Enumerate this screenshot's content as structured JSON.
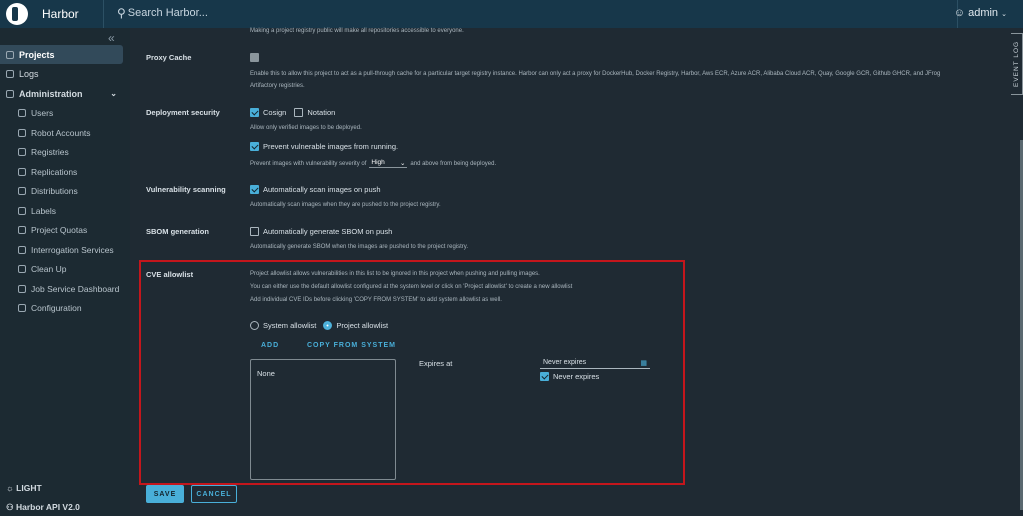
{
  "header": {
    "brand": "Harbor",
    "search_placeholder": "Search Harbor...",
    "user": "admin"
  },
  "sidebar": {
    "items": [
      {
        "label": "Projects",
        "icon": "projects-icon",
        "active": true
      },
      {
        "label": "Logs",
        "icon": "logs-icon"
      },
      {
        "label": "Administration",
        "icon": "administration-icon"
      },
      {
        "label": "Users",
        "icon": "users-icon"
      },
      {
        "label": "Robot Accounts",
        "icon": "robot-icon"
      },
      {
        "label": "Registries",
        "icon": "registries-icon"
      },
      {
        "label": "Replications",
        "icon": "replications-icon"
      },
      {
        "label": "Distributions",
        "icon": "distributions-icon"
      },
      {
        "label": "Labels",
        "icon": "labels-icon"
      },
      {
        "label": "Project Quotas",
        "icon": "quotas-icon"
      },
      {
        "label": "Interrogation Services",
        "icon": "interrogation-icon"
      },
      {
        "label": "Clean Up",
        "icon": "cleanup-icon"
      },
      {
        "label": "Job Service Dashboard",
        "icon": "dashboard-icon"
      },
      {
        "label": "Configuration",
        "icon": "configuration-icon"
      }
    ],
    "theme": "LIGHT",
    "api": "Harbor API V2.0"
  },
  "event_log": "EVENT LOG",
  "form": {
    "public_help": "Making a project registry public will make all repositories accessible to everyone.",
    "proxy_cache": {
      "label": "Proxy Cache",
      "help1": "Enable this to allow this project to act as a pull-through cache for a particular target registry instance. Harbor can only act a proxy for DockerHub, Docker Registry, Harbor, Aws ECR, Azure ACR, Alibaba Cloud ACR, Quay, Google GCR, Github GHCR, and JFrog",
      "help2": "Artifactory registries."
    },
    "deployment": {
      "label": "Deployment security",
      "cosign": "Cosign",
      "notation": "Notation",
      "help": "Allow only verified images to be deployed.",
      "prevent": "Prevent vulnerable images from running.",
      "severity_prefix": "Prevent images with vulnerability severity of",
      "severity": "High",
      "severity_suffix": "and above from being deployed."
    },
    "scanning": {
      "label": "Vulnerability scanning",
      "option": "Automatically scan images on push",
      "help": "Automatically scan images when they are pushed to the project registry."
    },
    "sbom": {
      "label": "SBOM generation",
      "option": "Automatically generate SBOM on push",
      "help": "Automatically generate SBOM when the images are pushed to the project registry."
    },
    "cve": {
      "label": "CVE allowlist",
      "help1": "Project allowlist allows vulnerabilities in this list to be ignored in this project when pushing and pulling images.",
      "help2": "You can either use the default allowlist configured at the system level or click on 'Project allowlist' to create a new allowlist",
      "help3": "Add individual CVE IDs before clicking 'COPY FROM SYSTEM' to add system allowlist as well.",
      "system": "System allowlist",
      "project": "Project allowlist",
      "add": "ADD",
      "copy": "COPY FROM SYSTEM",
      "list_empty": "None",
      "expires_label": "Expires at",
      "expires_value": "Never expires",
      "never_expires": "Never expires"
    },
    "save": "SAVE",
    "cancel": "CANCEL"
  }
}
